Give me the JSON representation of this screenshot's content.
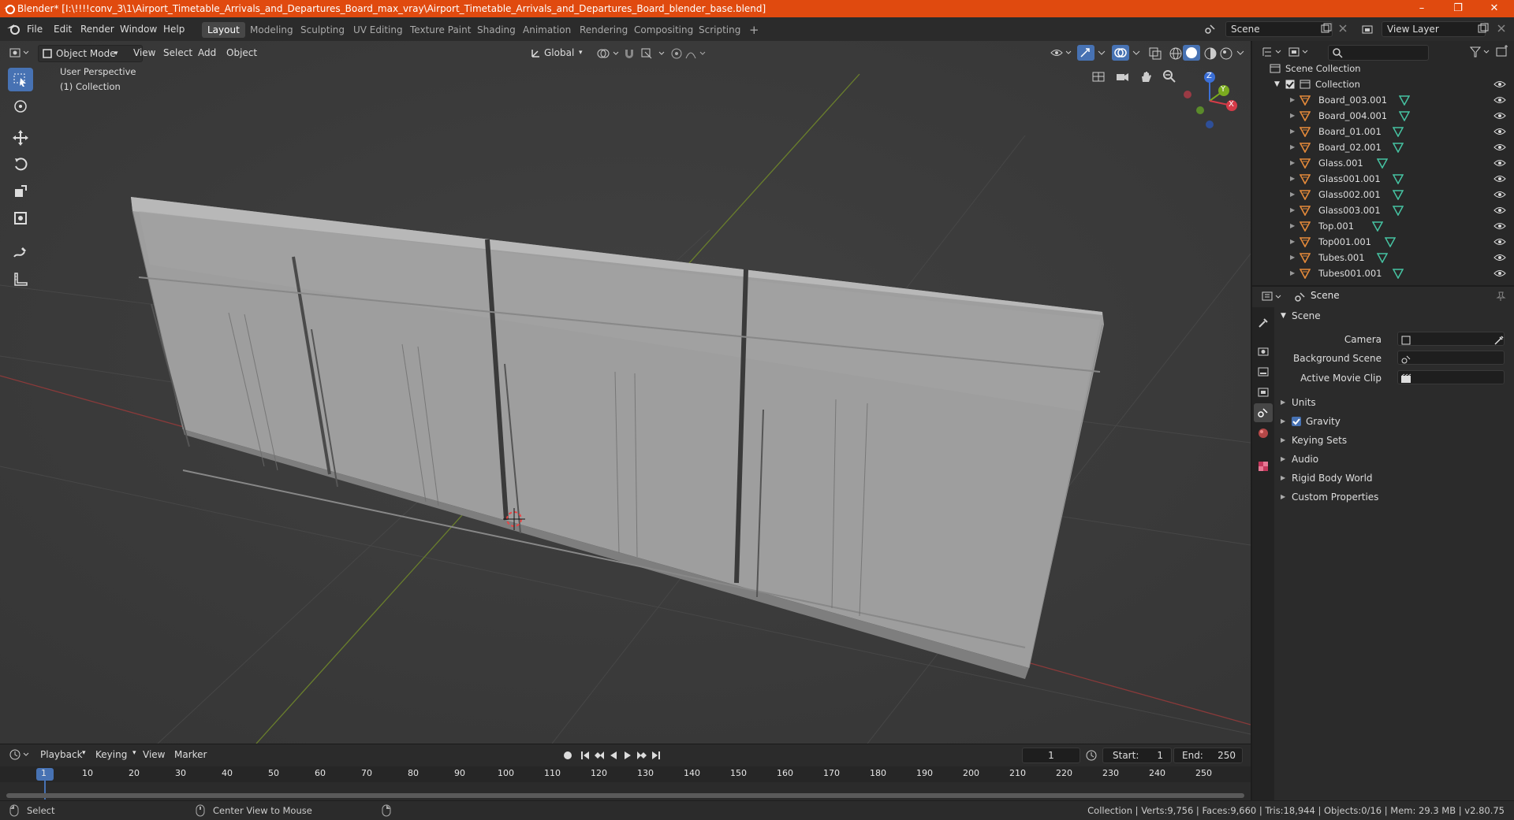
{
  "window": {
    "title": "Blender* [I:\\!!!!conv_3\\1\\Airport_Timetable_Arrivals_and_Departures_Board_max_vray\\Airport_Timetable_Arrivals_and_Departures_Board_blender_base.blend]",
    "minimize": "–",
    "maximize": "❐",
    "close": "✕"
  },
  "menu": [
    "File",
    "Edit",
    "Render",
    "Window",
    "Help"
  ],
  "workspaces": [
    "Layout",
    "Modeling",
    "Sculpting",
    "UV Editing",
    "Texture Paint",
    "Shading",
    "Animation",
    "Rendering",
    "Compositing",
    "Scripting"
  ],
  "workspace_add": "+",
  "scene_field": "Scene",
  "view_layer_field": "View Layer",
  "viewport_header": {
    "mode": "Object Mode",
    "menus": [
      "View",
      "Select",
      "Add",
      "Object"
    ],
    "transform": "Global"
  },
  "viewport": {
    "perspective": "User Perspective",
    "collection": "(1) Collection",
    "gizmo": {
      "x": "X",
      "y": "Y",
      "z": "Z"
    }
  },
  "outliner": {
    "search_placeholder": "",
    "root": "Scene Collection",
    "collection": "Collection",
    "items": [
      "Board_003.001",
      "Board_004.001",
      "Board_01.001",
      "Board_02.001",
      "Glass.001",
      "Glass001.001",
      "Glass002.001",
      "Glass003.001",
      "Top.001",
      "Top001.001",
      "Tubes.001",
      "Tubes001.001"
    ]
  },
  "properties": {
    "header": "Scene",
    "panel": "Scene",
    "fields": [
      {
        "label": "Camera",
        "value": ""
      },
      {
        "label": "Background Scene",
        "value": ""
      },
      {
        "label": "Active Movie Clip",
        "value": ""
      }
    ],
    "subpanels": [
      "Units",
      "Gravity",
      "Keying Sets",
      "Audio",
      "Rigid Body World",
      "Custom Properties"
    ],
    "gravity_checked": true
  },
  "timeline": {
    "menus": [
      "Playback",
      "Keying",
      "View",
      "Marker"
    ],
    "current_frame": "1",
    "start_label": "Start:",
    "start": "1",
    "end_label": "End:",
    "end": "250",
    "ticks": [
      "1",
      "10",
      "20",
      "30",
      "40",
      "50",
      "60",
      "70",
      "80",
      "90",
      "100",
      "110",
      "120",
      "130",
      "140",
      "150",
      "160",
      "170",
      "180",
      "190",
      "200",
      "210",
      "220",
      "230",
      "240",
      "250"
    ]
  },
  "status": {
    "left_action": "Select",
    "middle_action": "Center View to Mouse",
    "stats": "Collection | Verts:9,756 | Faces:9,660 | Tris:18,944 | Objects:0/16 | Mem: 29.3 MB | v2.80.75"
  },
  "colors": {
    "accent": "#4772b3",
    "titlebar": "#e04a0f",
    "mesh_orange": "#e58a3a",
    "mesh_green": "#46c3a2"
  }
}
